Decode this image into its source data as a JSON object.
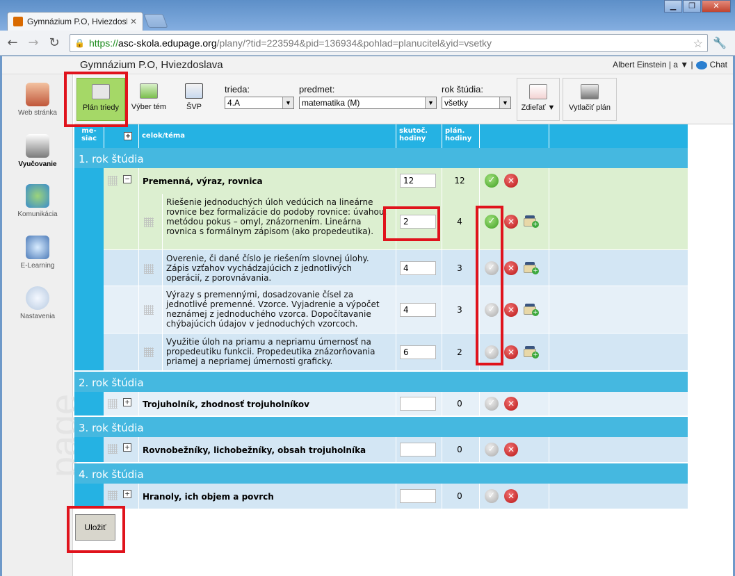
{
  "browser": {
    "tab_title": "Gymnázium P.O, Hviezdoslava",
    "url_https": "https://",
    "url_host": "asc-skola.edupage.org",
    "url_path": "/plany/?tid=223594&pid=136934&pohlad=planucitel&yid=vsetky"
  },
  "header": {
    "school": "Gymnázium P.O, Hviezdoslava",
    "user": "Albert Einstein | a ▼ |",
    "chat": "Chat"
  },
  "sidebar": {
    "items": [
      {
        "label": "Web stránka"
      },
      {
        "label": "Vyučovanie"
      },
      {
        "label": "Komunikácia"
      },
      {
        "label": "E-Learning"
      },
      {
        "label": "Nastavenia"
      }
    ],
    "watermark": "page"
  },
  "toolbar": {
    "plan_triedy": "Plán triedy",
    "vyber_tem": "Výber tém",
    "svp": "ŠVP",
    "trieda_label": "trieda:",
    "trieda_value": "4.A",
    "predmet_label": "predmet:",
    "predmet_value": "matematika (M)",
    "rok_label": "rok štúdia:",
    "rok_value": "všetky",
    "zdielat": "Zdieľať ▼",
    "vytlacit": "Vytlačiť plán"
  },
  "table": {
    "col_mesiac": "me-\nsiac",
    "col_celok": "celok/téma",
    "col_skut": "skutoč.\nhodiny",
    "col_plan": "plán.\nhodiny",
    "years": [
      "1. rok štúdia",
      "2. rok štúdia",
      "3. rok štúdia",
      "4. rok štúdia"
    ],
    "units": [
      {
        "title": "Premenná, výraz, rovnica",
        "actual": "12",
        "plan": "12"
      },
      {
        "title": "Trojuholník, zhodnosť trojuholníkov",
        "actual": "",
        "plan": "0"
      },
      {
        "title": "Rovnobežníky, lichobežníky, obsah trojuholníka",
        "actual": "",
        "plan": "0"
      },
      {
        "title": "Hranoly, ich objem a povrch",
        "actual": "",
        "plan": "0"
      }
    ],
    "topics": [
      {
        "text": "Riešenie jednoduchých úloh vedúcich na lineárne rovnice bez formalizácie do podoby rovnice: úvahou, metódou pokus – omyl, znázornením. Lineárna rovnica s formálnym zápisom (ako propedeutika).",
        "actual": "2",
        "plan": "4"
      },
      {
        "text": "Overenie, či dané číslo je riešením slovnej úlohy. Zápis vzťahov vychádzajúcich z jednotlivých operácií, z porovnávania.",
        "actual": "4",
        "plan": "3"
      },
      {
        "text": "Výrazy s premennými, dosadzovanie čísel za jednotlivé premenné. Vzorce. Vyjadrenie a výpočet neznámej z jednoduchého vzorca. Dopočítavanie chýbajúcich údajov v jednoduchých vzorcoch.",
        "actual": "4",
        "plan": "3"
      },
      {
        "text": "Využitie úloh na priamu a nepriamu úmernosť na propedeutiku funkcii. Propedeutika znázorňovania priamej a nepriamej úmernosti graficky.",
        "actual": "6",
        "plan": "2"
      }
    ]
  },
  "save_button": "Uložiť",
  "colors": {
    "header_blue": "#25b2e3",
    "unit_green": "#dcefd0",
    "topic_blue": "#d3e6f4",
    "highlight_red": "#e0131c"
  }
}
